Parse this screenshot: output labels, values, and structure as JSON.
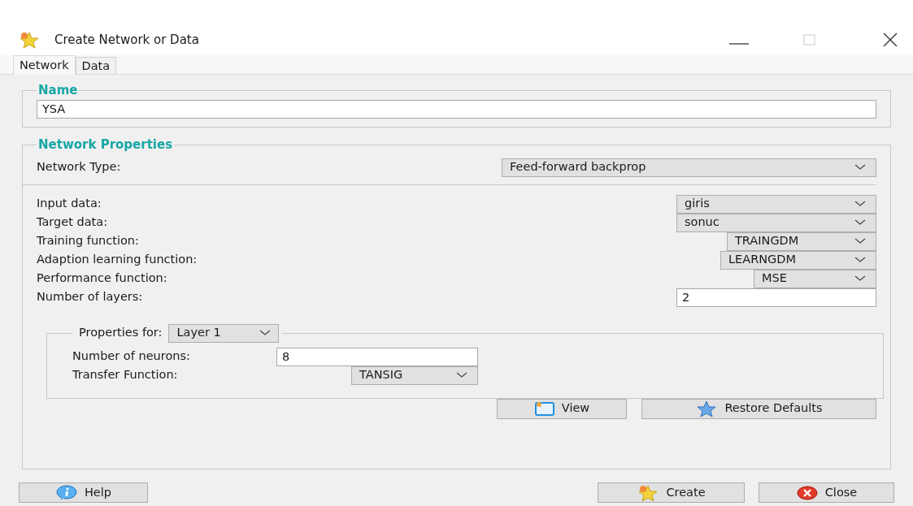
{
  "window": {
    "title": "Create Network or Data"
  },
  "tabs": [
    {
      "label": "Network",
      "selected": true
    },
    {
      "label": "Data",
      "selected": false
    }
  ],
  "name_group": {
    "title": "Name",
    "value": "YSA"
  },
  "network_properties": {
    "title": "Network Properties",
    "network_type": {
      "label": "Network Type:",
      "value": "Feed-forward backprop"
    },
    "fields": [
      {
        "kind": "dropdown",
        "label": "Input data:",
        "value": "giris"
      },
      {
        "kind": "dropdown",
        "label": "Target data:",
        "value": "sonuc"
      },
      {
        "kind": "dropdown",
        "label": "Training function:",
        "value": "TRAINGDM"
      },
      {
        "kind": "dropdown",
        "label": "Adaption learning function:",
        "value": "LEARNGDM"
      },
      {
        "kind": "dropdown",
        "label": "Performance function:",
        "value": "MSE"
      },
      {
        "kind": "text",
        "label": "Number of layers:",
        "value": "2"
      }
    ],
    "layer_properties": {
      "label": "Properties for:",
      "layer": "Layer 1",
      "fields": [
        {
          "kind": "text",
          "label": "Number of neurons:",
          "value": "8"
        },
        {
          "kind": "dropdown",
          "label": "Transfer Function:",
          "value": "TANSIG"
        }
      ]
    },
    "buttons": [
      {
        "kind": "view",
        "label": "View"
      },
      {
        "kind": "restore",
        "label": "Restore Defaults"
      }
    ]
  },
  "footer_buttons": [
    {
      "kind": "help",
      "label": "Help"
    },
    {
      "kind": "create",
      "label": "Create"
    },
    {
      "kind": "close",
      "label": "Close"
    }
  ]
}
